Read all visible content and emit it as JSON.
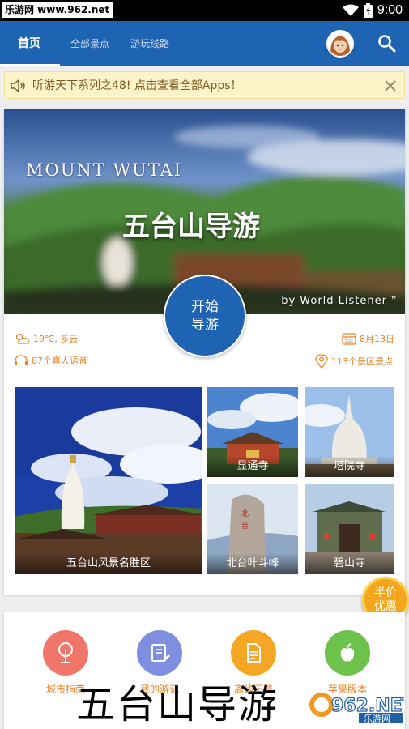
{
  "status_bar": {
    "watermark": "乐游网 www.962.net",
    "time": "9:00"
  },
  "tabs": [
    {
      "label": "首页"
    },
    {
      "label": "全部景点"
    },
    {
      "label": "游玩线路"
    }
  ],
  "notice": {
    "text": "听游天下系列之48! 点击查看全部Apps！"
  },
  "hero": {
    "title_en": "MOUNT WUTAI",
    "title_cn": "五台山导游",
    "byline": "by World Listener™",
    "start_line1": "开始",
    "start_line2": "导游"
  },
  "info": {
    "weather": "19℃, 多云",
    "date": "8月13日",
    "voices": "87个真人语音",
    "spots": "113个景区景点"
  },
  "tiles": [
    {
      "label": "五台山风景名胜区"
    },
    {
      "label": "显通寺"
    },
    {
      "label": "塔院寺"
    },
    {
      "label": "北台叶斗峰"
    },
    {
      "label": "碧山寺"
    }
  ],
  "badge": {
    "line1": "半价",
    "line2": "优惠"
  },
  "functions": [
    {
      "label": "城市指南",
      "color": "#f0766a"
    },
    {
      "label": "我的游记",
      "color": "#7f8fe0"
    },
    {
      "label": "离线下载",
      "color": "#f5a623"
    },
    {
      "label": "苹果版本",
      "color": "#6cc24a"
    }
  ],
  "overlay": {
    "title": "五台山导游"
  },
  "watermark_logo": {
    "text": "962.NET",
    "sub": "乐游网"
  },
  "colors": {
    "primary": "#1f63b3",
    "accent": "#e8852a",
    "notice_bg": "#fdf3c9"
  }
}
